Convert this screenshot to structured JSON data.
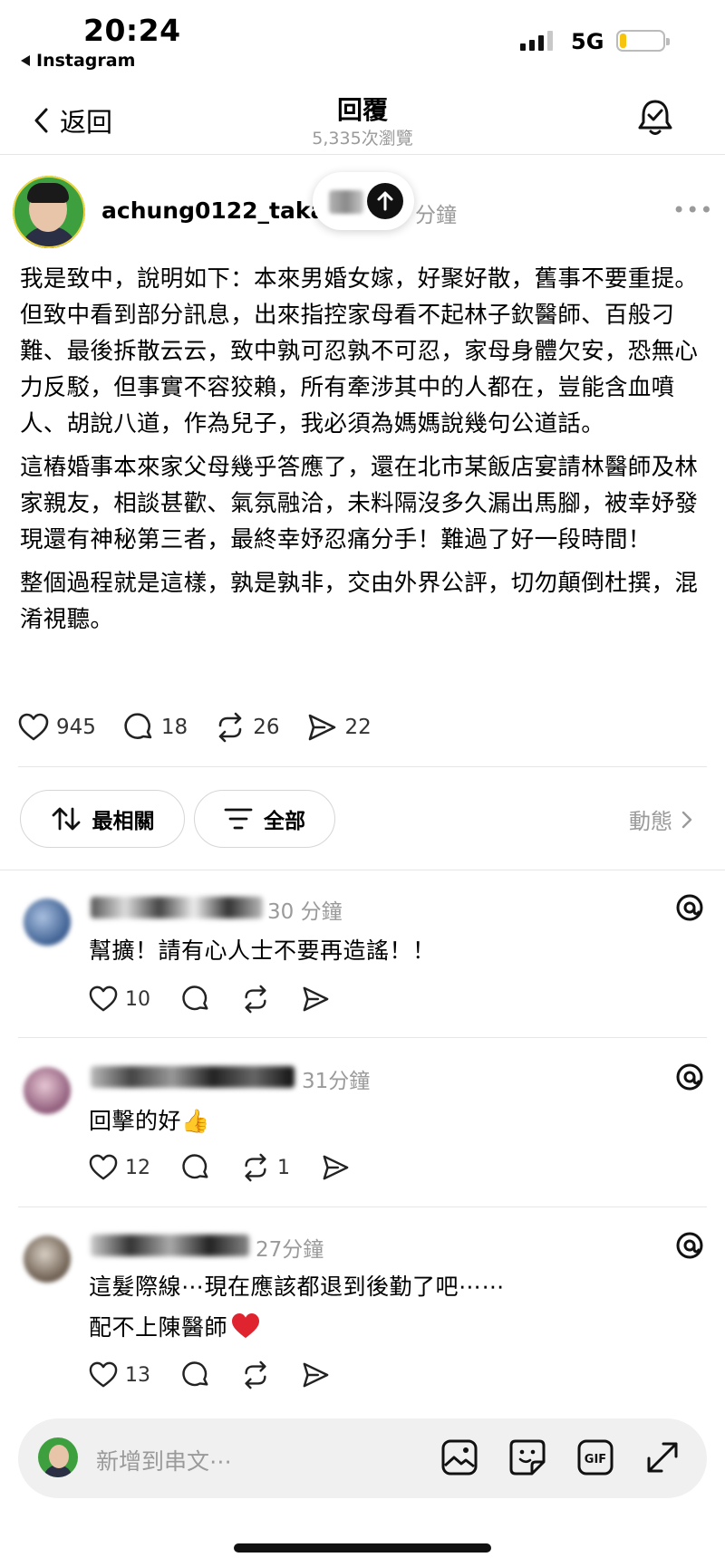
{
  "status_bar": {
    "time": "20:24",
    "back_app": "Instagram",
    "network": "5G"
  },
  "header": {
    "back_label": "返回",
    "title": "回覆",
    "views": "5,335次瀏覽"
  },
  "post": {
    "author": "achung0122_taka",
    "time_suffix": "分鐘",
    "paragraphs": [
      "我是致中，說明如下：本來男婚女嫁，好聚好散，舊事不要重提。但致中看到部分訊息，出來指控家母看不起林子欽醫師、百般刁難、最後拆散云云，致中孰可忍孰不可忍，家母身體欠安，恐無心力反駁，但事實不容狡賴，所有牽涉其中的人都在，豈能含血噴人、胡說八道，作為兒子，我必須為媽媽說幾句公道話。",
      "這樁婚事本來家父母幾乎答應了，還在北市某飯店宴請林醫師及林家親友，相談甚歡、氣氛融洽，未料隔沒多久漏出馬腳，被幸妤發現還有神秘第三者，最終幸妤忍痛分手！難過了好一段時間！",
      "整個過程就是這樣，孰是孰非，交由外界公評，切勿顛倒杜撰，混淆視聽。"
    ],
    "likes": "945",
    "comments": "18",
    "reposts": "26",
    "shares": "22"
  },
  "filters": {
    "sort_label": "最相關",
    "filter_label": "全部",
    "activity_label": "動態"
  },
  "replies": [
    {
      "time": "30 分鐘",
      "text": "幫擴！請有心人士不要再造謠！！",
      "likes": "10",
      "reposts": ""
    },
    {
      "time": "31分鐘",
      "text": "回擊的好",
      "emoji": "👍",
      "likes": "12",
      "reposts": "1"
    },
    {
      "time": "27分鐘",
      "text_line1": "這髮際線⋯現在應該都退到後勤了吧⋯⋯",
      "text_line2": "配不上陳醫師",
      "likes": "13",
      "reposts": ""
    }
  ],
  "composer": {
    "placeholder": "新增到串文⋯"
  },
  "icons": [
    "back-chevron-icon",
    "bell-check-icon",
    "heart-icon",
    "comment-icon",
    "repost-icon",
    "share-icon",
    "sort-icon",
    "filter-icon",
    "chevron-right-icon",
    "threads-icon",
    "image-icon",
    "sticker-icon",
    "gif-icon",
    "expand-icon"
  ],
  "colors": {
    "muted_text": "#9a9a9a",
    "heart_emoji": "#e0242f",
    "battery": "#f6c40d"
  }
}
